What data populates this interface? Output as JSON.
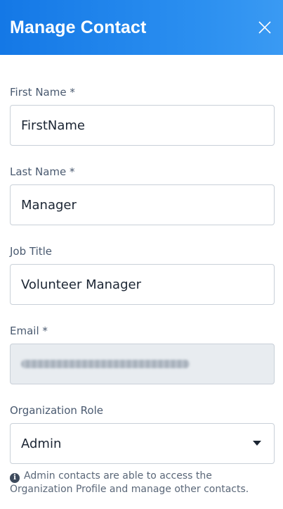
{
  "header": {
    "title": "Manage Contact",
    "close_icon": "close-icon"
  },
  "fields": {
    "first_name": {
      "label": "First Name *",
      "value": "FirstName"
    },
    "last_name": {
      "label": "Last Name *",
      "value": "Manager"
    },
    "job_title": {
      "label": "Job Title",
      "value": "Volunteer Manager"
    },
    "email": {
      "label": "Email *",
      "value": "",
      "disabled": true
    },
    "org_role": {
      "label": "Organization Role",
      "value": "Admin"
    }
  },
  "help": {
    "icon": "info-icon",
    "text": "Admin contacts are able to access the Organization Profile and manage other contacts."
  },
  "colors": {
    "header_start": "#1478e6",
    "header_end": "#3a9af3",
    "disabled_bg": "#e8ecf0"
  }
}
